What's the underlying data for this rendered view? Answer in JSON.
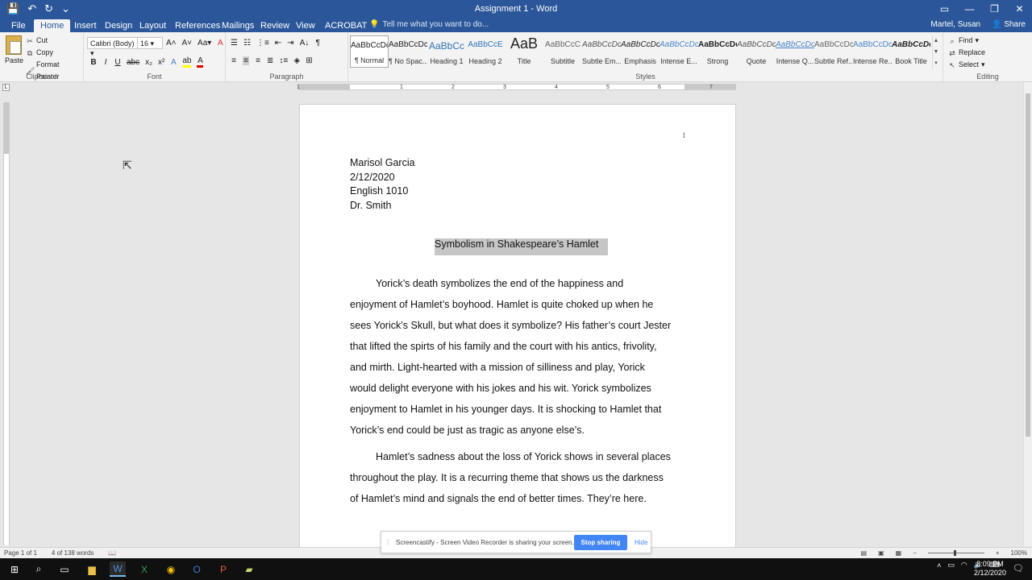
{
  "window": {
    "title": "Assignment 1 - Word",
    "user": "Martel, Susan",
    "share_label": "Share"
  },
  "qat": {
    "save": "💾",
    "undo": "↶",
    "redo": "↻",
    "more": "⌄"
  },
  "tabs": [
    "File",
    "Home",
    "Insert",
    "Design",
    "Layout",
    "References",
    "Mailings",
    "Review",
    "View",
    "ACROBAT"
  ],
  "tell_me": "Tell me what you want to do...",
  "ribbon": {
    "clipboard": {
      "label": "Clipboard",
      "paste": "Paste",
      "cut": "Cut",
      "copy": "Copy",
      "format_painter": "Format Painter"
    },
    "font": {
      "label": "Font",
      "name": "Calibri (Body)",
      "size": "16"
    },
    "paragraph": {
      "label": "Paragraph"
    },
    "styles": {
      "label": "Styles",
      "items": [
        {
          "sample": "AaBbCcDc",
          "name": "¶ Normal"
        },
        {
          "sample": "AaBbCcDc",
          "name": "¶ No Spac..."
        },
        {
          "sample": "AaBbCc",
          "name": "Heading 1"
        },
        {
          "sample": "AaBbCcE",
          "name": "Heading 2"
        },
        {
          "sample": "AaB",
          "name": "Title"
        },
        {
          "sample": "AaBbCcC",
          "name": "Subtitle"
        },
        {
          "sample": "AaBbCcDc",
          "name": "Subtle Em..."
        },
        {
          "sample": "AaBbCcDc",
          "name": "Emphasis"
        },
        {
          "sample": "AaBbCcDc",
          "name": "Intense E..."
        },
        {
          "sample": "AaBbCcDc",
          "name": "Strong"
        },
        {
          "sample": "AaBbCcDc",
          "name": "Quote"
        },
        {
          "sample": "AaBbCcDc",
          "name": "Intense Q..."
        },
        {
          "sample": "AaBbCcDc",
          "name": "Subtle Ref..."
        },
        {
          "sample": "AaBbCcDc",
          "name": "Intense Re..."
        },
        {
          "sample": "AaBbCcDc",
          "name": "Book Title"
        }
      ]
    },
    "editing": {
      "label": "Editing",
      "find": "Find",
      "replace": "Replace",
      "select": "Select"
    }
  },
  "ruler": {
    "ticks": [
      "1",
      "1",
      "2",
      "3",
      "4",
      "5",
      "6",
      "7"
    ]
  },
  "document": {
    "page_number": "1",
    "header_lines": [
      "Marisol Garcia",
      "2/12/2020",
      "English 1010",
      "Dr. Smith"
    ],
    "title": "Symbolism in Shakespeare’s Hamlet",
    "paragraph1_lines": [
      "Yorick’s death symbolizes the end of the happiness and",
      "enjoyment of Hamlet’s boyhood. Hamlet is quite choked up when he",
      "sees Yorick’s Skull, but what does it symbolize?  His father’s court Jester",
      "that lifted the spirts of his family and the court with his antics, frivolity,",
      "and mirth.  Light-hearted with a mission of silliness and play, Yorick",
      "would delight everyone with his jokes and his wit.  Yorick symbolizes",
      "enjoyment to Hamlet in his younger days.  It is shocking to Hamlet that",
      "Yorick’s end could be just as tragic as anyone else’s."
    ],
    "paragraph2_lines": [
      "Hamlet’s sadness about the loss of Yorick shows in several places",
      "throughout the play.  It is a recurring theme that shows us the darkness",
      "of Hamlet’s mind and signals the end of better times.  They’re here."
    ]
  },
  "status": {
    "page": "Page 1 of 1",
    "words": "4 of 138 words",
    "zoom": "100%"
  },
  "screencastify": {
    "message": "Screencastify - Screen Video Recorder is sharing your screen.",
    "stop": "Stop sharing",
    "hide": "Hide"
  },
  "taskbar": {
    "time": "8:09 PM",
    "date": "2/12/2020"
  }
}
